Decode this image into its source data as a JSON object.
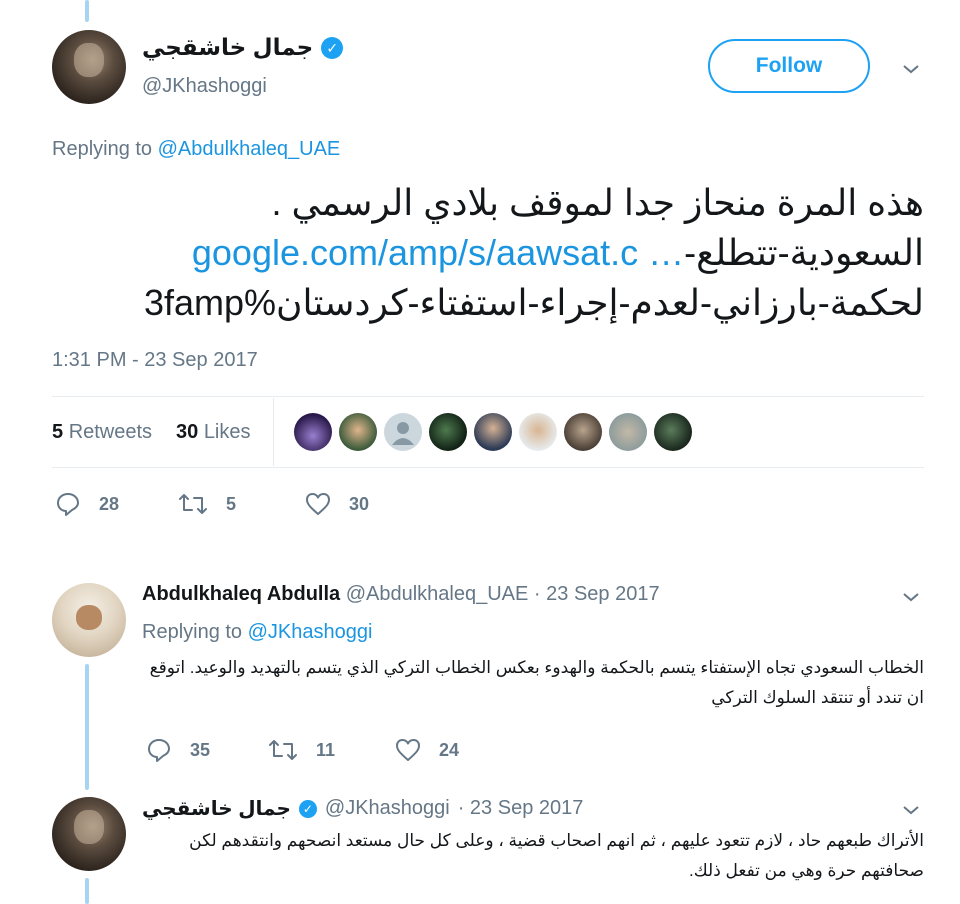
{
  "tweet": {
    "author_name": "جمال خاشقجي",
    "author_handle": "@JKhashoggi",
    "follow_label": "Follow",
    "replying_prefix": "Replying to",
    "replying_handle": "@Abdulkhaleq_UAE",
    "text_line1": "هذه المرة منحاز جدا لموقف بلادي الرسمي .",
    "text_line2_ar": "السعودية-تتطلع-",
    "text_line2_link": "google.com/amp/s/aawsat.c …",
    "text_line3": "لحكمة-بارزاني-لعدم-إجراء-استفتاء-كردستان%3famp",
    "timestamp": "1:31 PM - 23 Sep 2017",
    "retweets_count": "5",
    "retweets_label": "Retweets",
    "likes_count": "30",
    "likes_label": "Likes",
    "actions": {
      "replies": "28",
      "retweets": "5",
      "likes": "30"
    }
  },
  "reply1": {
    "author_name": "Abdulkhaleq Abdulla",
    "author_handle": "@Abdulkhaleq_UAE",
    "date": "· 23 Sep 2017",
    "replying_prefix": "Replying to",
    "replying_handle": "@JKhashoggi",
    "text_line1": "الخطاب السعودي تجاه الإستفتاء يتسم بالحكمة والهدوء بعكس الخطاب التركي الذي يتسم بالتهديد والوعيد. اتوقع",
    "text_line2": "ان تندد أو تنتقد السلوك التركي",
    "actions": {
      "replies": "35",
      "retweets": "11",
      "likes": "24"
    }
  },
  "reply2": {
    "author_name": "جمال خاشقجي",
    "author_handle": "@JKhashoggi",
    "date": "· 23 Sep 2017",
    "text_line1": "الأتراك طبعهم حاد ، لازم تتعود عليهم ، ثم انهم اصحاب قضية ، وعلى كل حال مستعد انصحهم وانتقدهم لكن",
    "text_line2": "صحافتهم حرة وهي من تفعل ذلك."
  },
  "colors": {
    "accent": "#1da1f2",
    "link": "#1b95e0",
    "muted": "#657786",
    "thread_line": "#a7d4f2"
  }
}
